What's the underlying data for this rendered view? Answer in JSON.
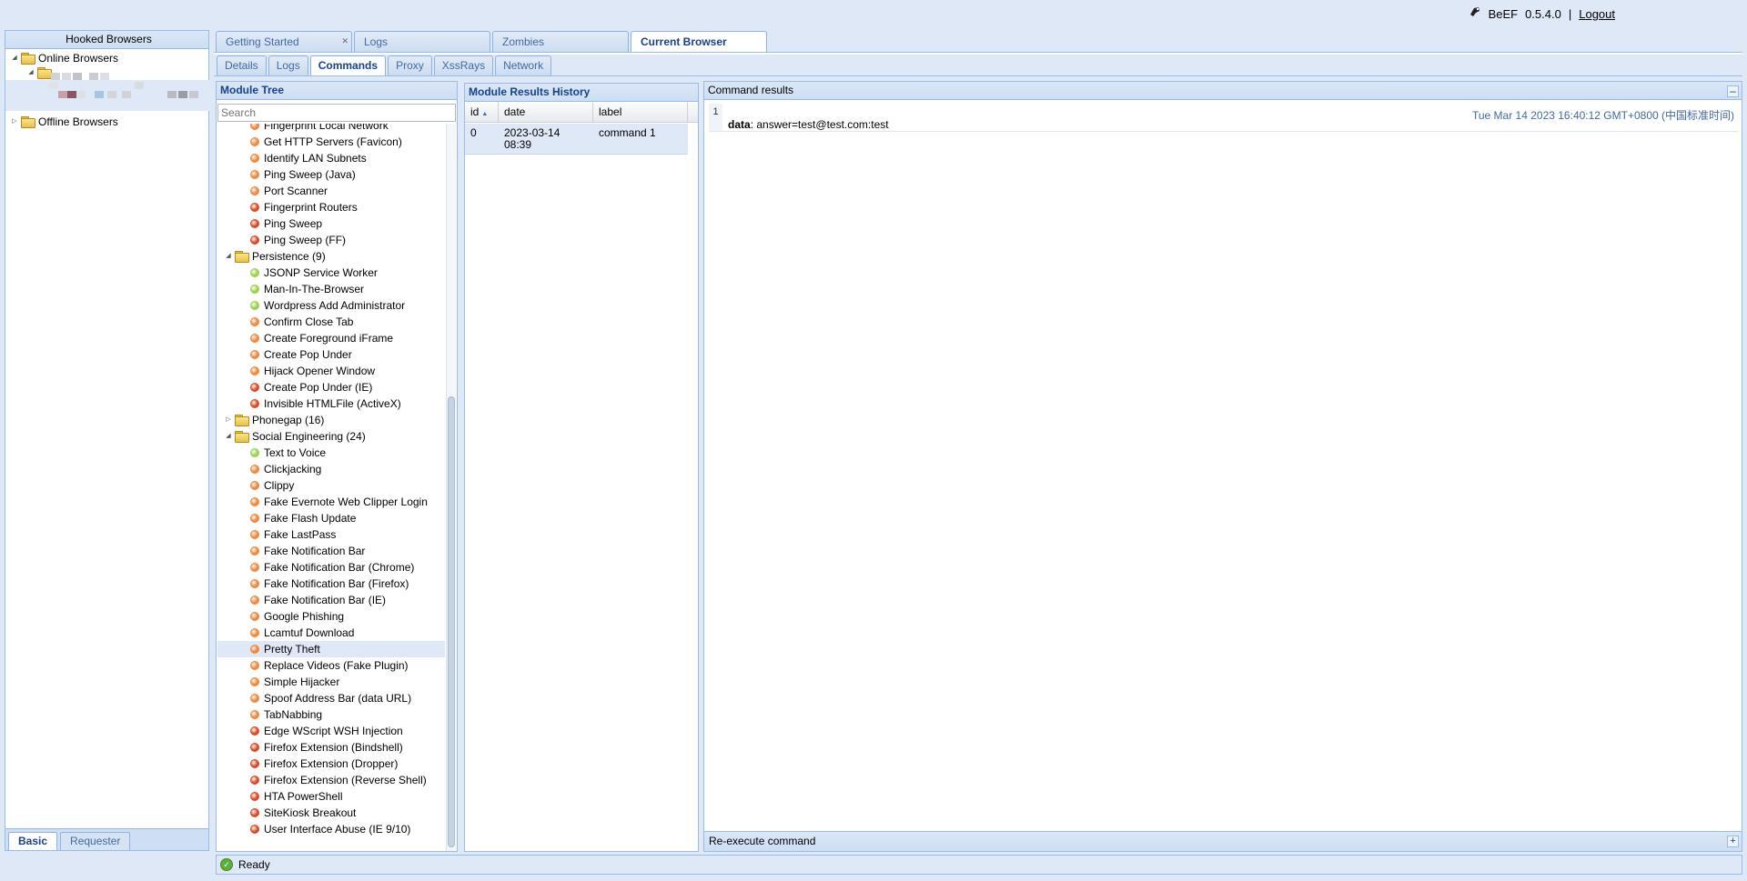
{
  "header": {
    "app_name": "BeEF",
    "version": "0.5.4.0",
    "separator": "|",
    "logout_label": "Logout"
  },
  "left_panel": {
    "title": "Hooked Browsers",
    "online_label": "Online Browsers",
    "offline_label": "Offline Browsers",
    "bottom_tabs": [
      "Basic",
      "Requester"
    ]
  },
  "top_tabs": [
    {
      "label": "Getting Started"
    },
    {
      "label": "Logs"
    },
    {
      "label": "Zombies"
    },
    {
      "label": "Current Browser"
    }
  ],
  "sub_tabs": [
    {
      "label": "Details"
    },
    {
      "label": "Logs"
    },
    {
      "label": "Commands"
    },
    {
      "label": "Proxy"
    },
    {
      "label": "XssRays"
    },
    {
      "label": "Network"
    }
  ],
  "module_tree": {
    "title": "Module Tree",
    "search_placeholder": "Search",
    "partial_top_label": "Fingerprint Local Network",
    "rows": [
      {
        "label": "Fingerprint Local Network",
        "color": "#f0883c"
      },
      {
        "label": "Get HTTP Servers (Favicon)",
        "color": "#f0883c"
      },
      {
        "label": "Identify LAN Subnets",
        "color": "#f0883c"
      },
      {
        "label": "Ping Sweep (Java)",
        "color": "#f0883c"
      },
      {
        "label": "Port Scanner",
        "color": "#f0883c"
      },
      {
        "label": "Fingerprint Routers",
        "color": "#de4a26"
      },
      {
        "label": "Ping Sweep",
        "color": "#de4a26"
      },
      {
        "label": "Ping Sweep (FF)",
        "color": "#de4a26"
      },
      {
        "label": "Persistence (9)",
        "category": true,
        "expanded": true
      },
      {
        "label": "JSONP Service Worker",
        "color": "#9cd24e"
      },
      {
        "label": "Man-In-The-Browser",
        "color": "#9cd24e"
      },
      {
        "label": "Wordpress Add Administrator",
        "color": "#9cd24e"
      },
      {
        "label": "Confirm Close Tab",
        "color": "#f0883c"
      },
      {
        "label": "Create Foreground iFrame",
        "color": "#f0883c"
      },
      {
        "label": "Create Pop Under",
        "color": "#f0883c"
      },
      {
        "label": "Hijack Opener Window",
        "color": "#f0883c"
      },
      {
        "label": "Create Pop Under (IE)",
        "color": "#de4a26"
      },
      {
        "label": "Invisible HTMLFile (ActiveX)",
        "color": "#de4a26"
      },
      {
        "label": "Phonegap (16)",
        "category": true,
        "expanded": false
      },
      {
        "label": "Social Engineering (24)",
        "category": true,
        "expanded": true
      },
      {
        "label": "Text to Voice",
        "color": "#9cd24e"
      },
      {
        "label": "Clickjacking",
        "color": "#f0883c"
      },
      {
        "label": "Clippy",
        "color": "#f0883c"
      },
      {
        "label": "Fake Evernote Web Clipper Login",
        "color": "#f0883c"
      },
      {
        "label": "Fake Flash Update",
        "color": "#f0883c"
      },
      {
        "label": "Fake LastPass",
        "color": "#f0883c"
      },
      {
        "label": "Fake Notification Bar",
        "color": "#f0883c"
      },
      {
        "label": "Fake Notification Bar (Chrome)",
        "color": "#f0883c"
      },
      {
        "label": "Fake Notification Bar (Firefox)",
        "color": "#f0883c"
      },
      {
        "label": "Fake Notification Bar (IE)",
        "color": "#f0883c"
      },
      {
        "label": "Google Phishing",
        "color": "#f0883c"
      },
      {
        "label": "Lcamtuf Download",
        "color": "#f0883c"
      },
      {
        "label": "Pretty Theft",
        "color": "#f0883c",
        "selected": true
      },
      {
        "label": "Replace Videos (Fake Plugin)",
        "color": "#f0883c"
      },
      {
        "label": "Simple Hijacker",
        "color": "#f0883c"
      },
      {
        "label": "Spoof Address Bar (data URL)",
        "color": "#f0883c"
      },
      {
        "label": "TabNabbing",
        "color": "#f0883c"
      },
      {
        "label": "Edge WScript WSH Injection",
        "color": "#de4a26"
      },
      {
        "label": "Firefox Extension (Bindshell)",
        "color": "#de4a26"
      },
      {
        "label": "Firefox Extension (Dropper)",
        "color": "#de4a26"
      },
      {
        "label": "Firefox Extension (Reverse Shell)",
        "color": "#de4a26"
      },
      {
        "label": "HTA PowerShell",
        "color": "#de4a26"
      },
      {
        "label": "SiteKiosk Breakout",
        "color": "#de4a26"
      },
      {
        "label": "User Interface Abuse (IE 9/10)",
        "color": "#de4a26"
      }
    ]
  },
  "history": {
    "title": "Module Results History",
    "columns": [
      "id",
      "date",
      "label"
    ],
    "rows": [
      {
        "id": "0",
        "date": "2023-03-14 08:39",
        "label": "command 1"
      }
    ]
  },
  "results": {
    "title": "Command results",
    "entry_number": "1",
    "timestamp": "Tue Mar 14 2023 16:40:12 GMT+0800 (中国标准时间)",
    "data_key": "data",
    "data_value": ": answer=test@test.com:test",
    "footer": "Re-execute command"
  },
  "status": {
    "text": "Ready"
  }
}
